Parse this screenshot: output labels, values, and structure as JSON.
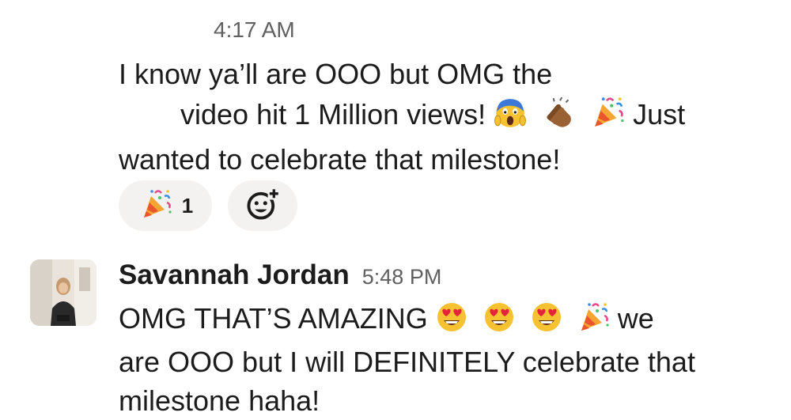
{
  "top_timestamp": "4:17 AM",
  "message1": {
    "line1": "I know ya’ll are OOO but OMG the",
    "line2_text": "video hit 1 Million views!",
    "line2_emojis": [
      "face-screaming-in-fear",
      "clapping-hands",
      "party-popper"
    ],
    "line2_tail": "Just",
    "line3": "wanted to celebrate that milestone!"
  },
  "reactions": [
    {
      "emoji": "party-popper",
      "count": "1"
    },
    {
      "emoji": "add-reaction"
    }
  ],
  "message2": {
    "author": "Savannah Jordan",
    "time": "5:48 PM",
    "text_before_emojis": "OMG THAT’S AMAZING",
    "emojis": [
      "smiling-face-with-heart-eyes",
      "smiling-face-with-heart-eyes",
      "smiling-face-with-heart-eyes",
      "party-popper"
    ],
    "text_after_emojis": "we",
    "line2": "are OOO but I will DEFINITELY celebrate that",
    "line3": "milestone haha!"
  },
  "colors": {
    "text": "#1d1c1d",
    "muted": "#616061",
    "reaction_bg": "#f3f2f0"
  }
}
